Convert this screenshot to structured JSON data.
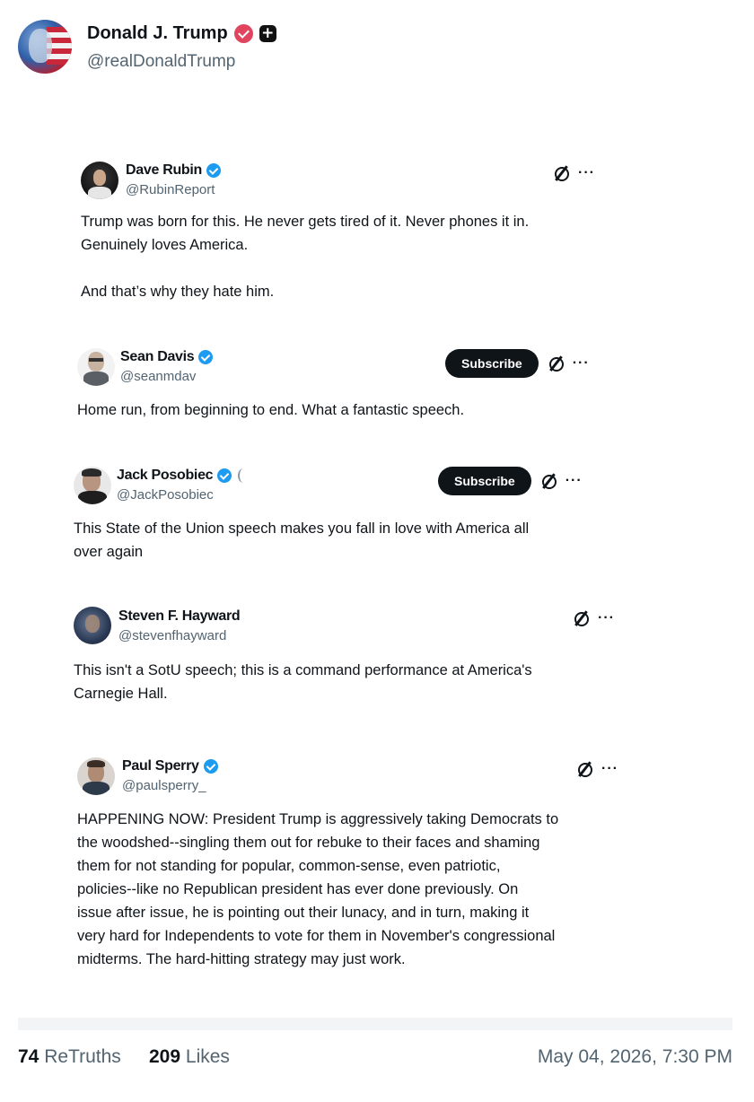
{
  "post": {
    "display_name": "Donald J. Trump",
    "handle": "@realDonaldTrump",
    "verified_icon": "verified-badge-icon",
    "plus_icon": "plus-badge-icon",
    "plus_glyph": "+"
  },
  "tweets": [
    {
      "name": "Dave Rubin",
      "handle": "@RubinReport",
      "text": "Trump was born for this. He never gets tired of it. Never phones it in.\nGenuinely loves America.\n\nAnd that’s why they hate him.",
      "subscribe": false
    },
    {
      "name": "Sean Davis",
      "handle": "@seanmdav",
      "text": "Home run, from beginning to end. What a fantastic speech.",
      "subscribe": true,
      "subscribe_label": "Subscribe"
    },
    {
      "name": "Jack Posobiec",
      "handle": "@JackPosobiec",
      "text": "This State of the Union speech makes you fall in love with America all\nover again",
      "subscribe": true,
      "subscribe_label": "Subscribe"
    },
    {
      "name": "Steven F. Hayward",
      "handle": "@stevenfhayward",
      "text": "This isn't a SotU speech; this is a command performance at America's\nCarnegie Hall.",
      "subscribe": false
    },
    {
      "name": "Paul Sperry",
      "handle": "@paulsperry_",
      "text": "HAPPENING NOW: President Trump is aggressively taking Democrats to\nthe woodshed--singling them out for rebuke to their faces and shaming\nthem for not standing for popular, common-sense, even patriotic,\npolicies--like no Republican president has ever done previously. On\nissue after issue, he is pointing out their lunacy, and in turn, making it\nvery hard for Independents to vote for them in November's congressional\nmidterms. The hard-hitting strategy may just work.",
      "subscribe": false
    }
  ],
  "icons": {
    "more": "···"
  },
  "footer": {
    "retruths_count": "74",
    "retruths_label": "ReTruths",
    "likes_count": "209",
    "likes_label": "Likes",
    "date": "May 04, 2026, 7:30 PM"
  },
  "colors": {
    "verified_pink": "#e0445f",
    "verified_blue": "#1d9bf0",
    "text_secondary": "#536471"
  }
}
